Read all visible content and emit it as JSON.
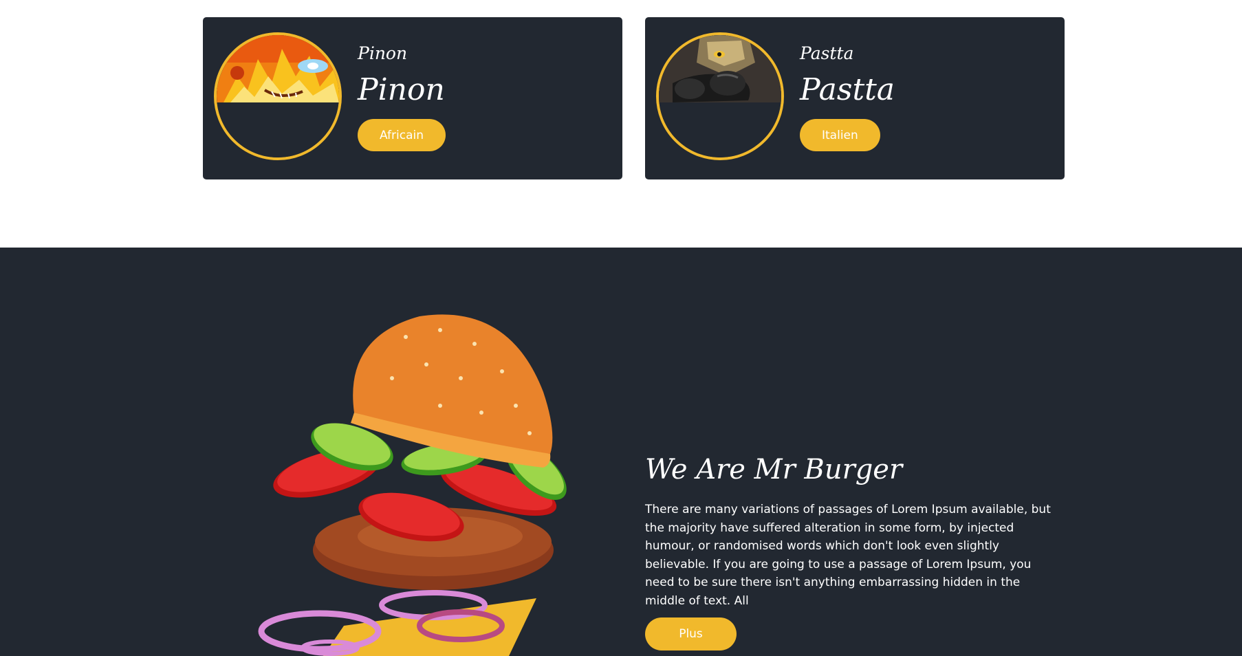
{
  "cards": [
    {
      "subtitle": "Pinon",
      "title": "Pinon",
      "tag": "Africain"
    },
    {
      "subtitle": "Pastta",
      "title": "Pastta",
      "tag": "Italien"
    }
  ],
  "about": {
    "title": "We Are Mr Burger",
    "text": "There are many variations of passages of Lorem Ipsum available, but the majority have suffered alteration in some form, by injected humour, or randomised words which don't look even slightly believable. If you are going to use a passage of Lorem Ipsum, you need to be sure there isn't anything embarrassing hidden in the middle of text. All",
    "button": "Plus"
  },
  "colors": {
    "accent": "#f1b92c",
    "dark_bg": "#222831",
    "white": "#ffffff"
  },
  "icons": [
    "burger-illustration",
    "fire-character-image",
    "dark-character-image"
  ]
}
